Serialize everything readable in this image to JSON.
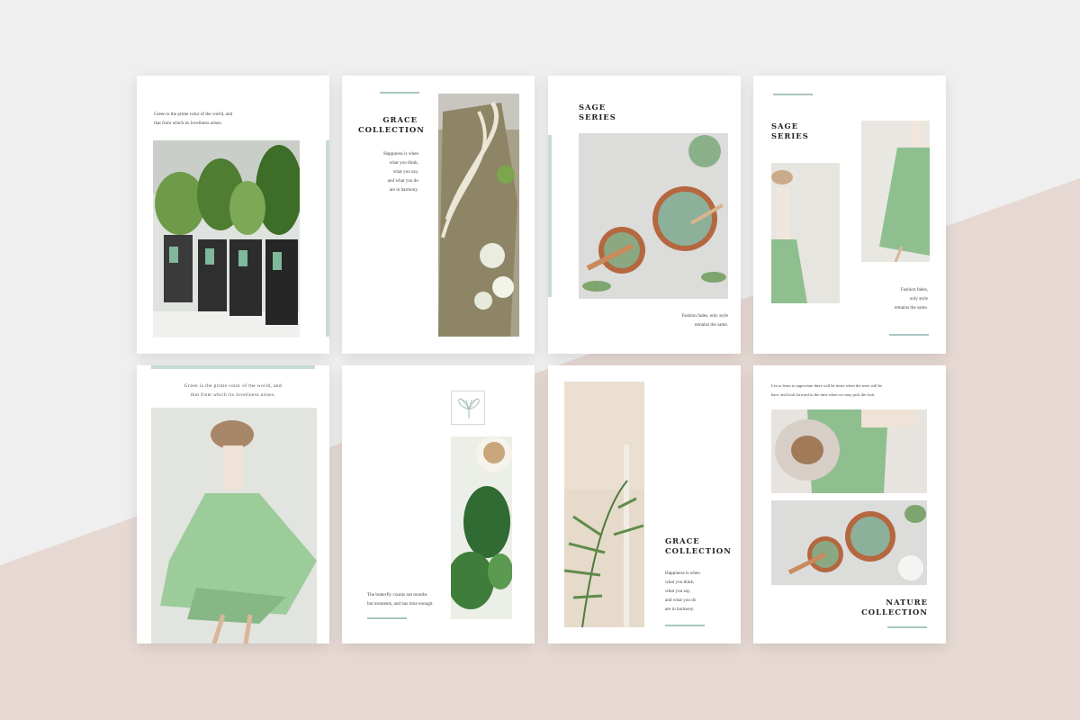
{
  "colors": {
    "background_light": "#efefef",
    "background_blush": "#e6d9d3",
    "accent_rule": "#a9c4c2",
    "sage_green": "#a6cfa6",
    "card": "#ffffff"
  },
  "cards": {
    "c1": {
      "body": "Green is the prime color of the world, and\nthat from which its loveliness arises."
    },
    "c2": {
      "title": "GRACE\nCOLLECTION",
      "body": "Happiness is when\nwhat you think,\nwhat you say,\nand what you do\nare in harmony."
    },
    "c3": {
      "title": "SAGE\nSERIES",
      "body": "Fashion fades, only style\nremains the same."
    },
    "c4": {
      "title": "SAGE\nSERIES",
      "body": "Fashion fades,\nonly style\nremains the same."
    },
    "c5": {
      "body": "Green is the prime color of the world, and\nthat from which its loveliness arises."
    },
    "c6": {
      "body": "The butterfly counts not months\nbut moments, and has time enough."
    },
    "c7": {
      "title": "GRACE\nCOLLECTION",
      "body": "Happiness is when\nwhat you think,\nwhat you say,\nand what you do\nare in harmony."
    },
    "c8": {
      "body": "Let us learn to appreciate there will be times when the trees will be\nbare, and look forward to the time when we may pick the fruit.",
      "title": "NATURE\nCOLLECTION"
    }
  },
  "icons": {
    "ginkgo": "ginkgo-leaf-icon"
  }
}
